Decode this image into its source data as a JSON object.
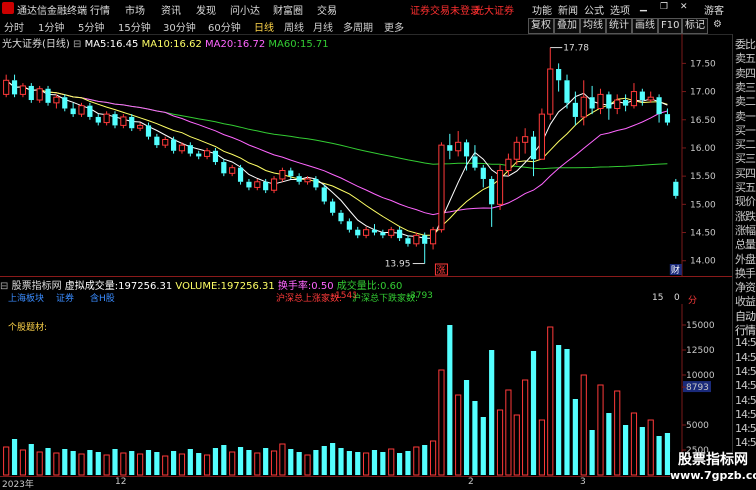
{
  "titlebar": {
    "app_title": "通达信金融终端",
    "menus": [
      "行情",
      "市场",
      "资讯",
      "发现",
      "问小达",
      "财富圈",
      "交易"
    ],
    "notice": "证券交易未登录",
    "broker": "光大证券",
    "right_menus": [
      "功能",
      "新闻",
      "公式",
      "选项"
    ],
    "user": "游客"
  },
  "toolbar": {
    "periods": [
      "分时",
      "1分钟",
      "5分钟",
      "15分钟",
      "30分钟",
      "60分钟",
      "日线",
      "周线",
      "月线",
      "多周期",
      "更多"
    ],
    "active": "日线",
    "buttons": [
      "复权",
      "叠加",
      "均线",
      "统计",
      "画线",
      "F10",
      "标记"
    ]
  },
  "chart_info": {
    "security": "光大证券(日线)",
    "ma5_label": "MA5:",
    "ma5": "16.45",
    "ma10_label": "MA10:",
    "ma10": "16.62",
    "ma20_label": "MA20:",
    "ma20": "16.72",
    "ma60_label": "MA60:",
    "ma60": "15.71",
    "max_label": "17.78",
    "min_label": "13.95",
    "marker_zhang": "涨",
    "marker_cai": "财"
  },
  "price_axis": [
    "17.50",
    "17.00",
    "16.50",
    "16.00",
    "15.50",
    "15.00",
    "14.50",
    "14.00"
  ],
  "indicator": {
    "name": "股票指标网",
    "vol_label": "虚拟成交量:",
    "vol_value": "197256.31",
    "volume_label": "VOLUME:",
    "volume_value": "197256.31",
    "turnover_label": "换手率:",
    "turnover": "0.50",
    "vol_ratio_label": "成交量比:",
    "vol_ratio": "0.60",
    "market_labels": [
      "上海板块",
      "证券",
      "含H股"
    ],
    "up_label": "沪深总上涨家数:",
    "up": "1541",
    "down_label": "沪深总下跌家数:",
    "down": "3793",
    "count_a": "15",
    "count_b": "0",
    "count_unit": "分",
    "stock_topic": "个股题材:"
  },
  "volume_axis": [
    "15000",
    "12500",
    "10000",
    "8793",
    "5000",
    "2500"
  ],
  "date_axis": [
    "2023年",
    "12",
    "2",
    "3"
  ],
  "sidebar": [
    "委比",
    "卖五",
    "卖四",
    "卖三",
    "卖二",
    "卖一",
    "买一",
    "买二",
    "买三",
    "买四",
    "买五",
    "现价",
    "涨跌",
    "涨幅",
    "总量",
    "外盘",
    "换手",
    "净资",
    "收益",
    "自动",
    "行情",
    "14:5",
    "14:5",
    "14:5",
    "14:5",
    "14:5",
    "14:5",
    "14:5",
    "14:5",
    "14:5",
    "14:5"
  ],
  "watermark": {
    "title": "股票指标网",
    "url": "www.7gpzb.com"
  },
  "colors": {
    "up": "#ff3a3a",
    "down": "#54ffff",
    "ma5": "#ffffff",
    "ma10": "#ffff66",
    "ma20": "#ff66ff",
    "ma60": "#33cc33"
  },
  "chart_data": {
    "type": "candlestick",
    "ylim": [
      13.8,
      17.95
    ],
    "candles": [
      [
        16.95,
        17.2,
        16.9,
        17.3
      ],
      [
        17.2,
        16.95,
        16.9,
        17.3
      ],
      [
        16.95,
        17.1,
        16.9,
        17.15
      ],
      [
        17.1,
        16.85,
        16.8,
        17.15
      ],
      [
        16.85,
        17.05,
        16.8,
        17.1
      ],
      [
        17.05,
        16.8,
        16.75,
        17.1
      ],
      [
        16.8,
        16.9,
        16.7,
        16.95
      ],
      [
        16.9,
        16.7,
        16.65,
        16.95
      ],
      [
        16.7,
        16.6,
        16.55,
        16.8
      ],
      [
        16.6,
        16.75,
        16.55,
        16.8
      ],
      [
        16.75,
        16.55,
        16.5,
        16.8
      ],
      [
        16.55,
        16.45,
        16.4,
        16.6
      ],
      [
        16.45,
        16.6,
        16.4,
        16.65
      ],
      [
        16.6,
        16.4,
        16.35,
        16.65
      ],
      [
        16.4,
        16.55,
        16.35,
        16.6
      ],
      [
        16.55,
        16.35,
        16.3,
        16.6
      ],
      [
        16.35,
        16.4,
        16.3,
        16.45
      ],
      [
        16.4,
        16.2,
        16.15,
        16.45
      ],
      [
        16.2,
        16.05,
        16.0,
        16.25
      ],
      [
        16.05,
        16.15,
        16.0,
        16.2
      ],
      [
        16.15,
        15.95,
        15.9,
        16.2
      ],
      [
        15.95,
        16.05,
        15.9,
        16.1
      ],
      [
        16.05,
        15.9,
        15.85,
        16.1
      ],
      [
        15.9,
        15.85,
        15.8,
        15.95
      ],
      [
        15.85,
        15.95,
        15.8,
        16.0
      ],
      [
        15.95,
        15.75,
        15.7,
        16.0
      ],
      [
        15.75,
        15.55,
        15.5,
        15.8
      ],
      [
        15.55,
        15.65,
        15.5,
        15.7
      ],
      [
        15.65,
        15.4,
        15.35,
        15.7
      ],
      [
        15.4,
        15.3,
        15.25,
        15.45
      ],
      [
        15.3,
        15.4,
        15.25,
        15.45
      ],
      [
        15.4,
        15.25,
        15.2,
        15.45
      ],
      [
        15.25,
        15.45,
        15.2,
        15.5
      ],
      [
        15.45,
        15.6,
        15.4,
        15.65
      ],
      [
        15.6,
        15.5,
        15.45,
        15.65
      ],
      [
        15.5,
        15.4,
        15.35,
        15.55
      ],
      [
        15.4,
        15.45,
        15.35,
        15.5
      ],
      [
        15.45,
        15.3,
        15.25,
        15.5
      ],
      [
        15.3,
        15.05,
        15.0,
        15.35
      ],
      [
        15.05,
        14.85,
        14.8,
        15.1
      ],
      [
        14.85,
        14.7,
        14.65,
        14.9
      ],
      [
        14.7,
        14.55,
        14.5,
        14.75
      ],
      [
        14.55,
        14.45,
        14.4,
        14.6
      ],
      [
        14.45,
        14.55,
        14.4,
        14.6
      ],
      [
        14.55,
        14.5,
        14.45,
        14.65
      ],
      [
        14.5,
        14.45,
        14.4,
        14.55
      ],
      [
        14.45,
        14.55,
        14.4,
        14.6
      ],
      [
        14.55,
        14.4,
        14.35,
        14.6
      ],
      [
        14.4,
        14.3,
        14.25,
        14.45
      ],
      [
        14.3,
        14.45,
        14.25,
        14.5
      ],
      [
        14.45,
        14.3,
        13.95,
        14.5
      ],
      [
        14.3,
        14.55,
        14.2,
        14.6
      ],
      [
        14.55,
        16.05,
        14.5,
        16.1
      ],
      [
        16.05,
        15.95,
        15.8,
        16.25
      ],
      [
        15.95,
        16.1,
        15.85,
        16.3
      ],
      [
        16.1,
        15.85,
        15.6,
        16.15
      ],
      [
        15.85,
        15.65,
        15.6,
        16.05
      ],
      [
        15.65,
        15.45,
        15.3,
        15.7
      ],
      [
        15.45,
        15.0,
        14.6,
        15.5
      ],
      [
        15.0,
        15.6,
        14.9,
        15.7
      ],
      [
        15.6,
        15.8,
        15.5,
        15.9
      ],
      [
        15.8,
        16.1,
        15.7,
        16.2
      ],
      [
        16.1,
        16.2,
        15.9,
        16.35
      ],
      [
        16.2,
        15.8,
        15.5,
        16.3
      ],
      [
        15.8,
        16.6,
        15.8,
        16.7
      ],
      [
        16.6,
        17.4,
        16.5,
        17.78
      ],
      [
        17.4,
        17.2,
        17.0,
        17.5
      ],
      [
        17.2,
        16.8,
        16.7,
        17.3
      ],
      [
        16.8,
        16.55,
        16.4,
        17.0
      ],
      [
        16.55,
        16.9,
        16.4,
        17.2
      ],
      [
        16.9,
        16.7,
        16.6,
        17.1
      ],
      [
        16.7,
        16.95,
        16.6,
        17.05
      ],
      [
        16.95,
        16.7,
        16.5,
        17.0
      ],
      [
        16.7,
        16.85,
        16.6,
        16.95
      ],
      [
        16.85,
        16.75,
        16.65,
        16.95
      ],
      [
        16.75,
        17.0,
        16.7,
        17.15
      ],
      [
        17.0,
        16.85,
        16.75,
        17.05
      ],
      [
        16.85,
        16.9,
        16.8,
        17.0
      ],
      [
        16.9,
        16.6,
        16.45,
        16.95
      ],
      [
        16.6,
        16.45,
        16.4,
        16.7
      ],
      [
        15.4,
        15.15,
        15.1,
        15.45
      ]
    ],
    "volume": [
      2800,
      3600,
      2500,
      3100,
      2300,
      2700,
      2200,
      2600,
      2400,
      2100,
      2500,
      2300,
      2000,
      2600,
      2200,
      2400,
      2100,
      2500,
      2300,
      1900,
      2400,
      2100,
      2600,
      2200,
      2000,
      2700,
      3000,
      2300,
      2800,
      2500,
      2200,
      2700,
      2400,
      3100,
      2600,
      2300,
      2000,
      2500,
      2900,
      3200,
      2700,
      2400,
      2300,
      2200,
      2500,
      2300,
      2600,
      2200,
      2400,
      2800,
      3000,
      3400,
      10500,
      15000,
      8000,
      9500,
      7400,
      5800,
      12500,
      6500,
      8500,
      6000,
      9500,
      12400,
      5500,
      14800,
      13000,
      12600,
      7600,
      10000,
      4500,
      9000,
      6200,
      8400,
      5000,
      6200,
      4800,
      5500,
      3900,
      4200,
      1900
    ],
    "ma_period_labels": [
      "MA5",
      "MA10",
      "MA20",
      "MA60"
    ]
  }
}
